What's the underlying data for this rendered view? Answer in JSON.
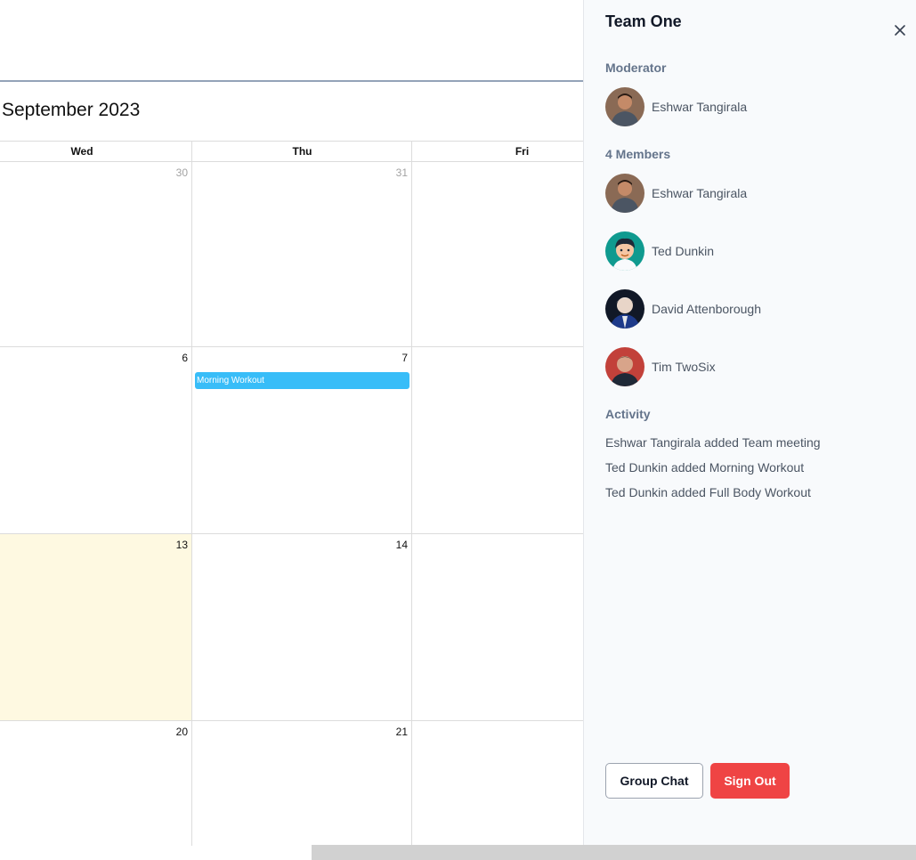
{
  "calendar": {
    "month_title": "September 2023",
    "headers": [
      "Wed",
      "Thu",
      "Fri"
    ],
    "weeks": [
      [
        {
          "day": "30",
          "other": true
        },
        {
          "day": "31",
          "other": true
        },
        {
          "day": "",
          "other": false
        }
      ],
      [
        {
          "day": "6"
        },
        {
          "day": "7",
          "event": "Morning Workout"
        },
        {
          "day": ""
        }
      ],
      [
        {
          "day": "13",
          "today": true
        },
        {
          "day": "14"
        },
        {
          "day": ""
        }
      ],
      [
        {
          "day": "20"
        },
        {
          "day": "21"
        },
        {
          "day": ""
        }
      ]
    ],
    "event_color": "#38bdf8",
    "today_color": "#fef9e1"
  },
  "panel": {
    "title": "Team One",
    "close_icon": "close-icon",
    "moderator_label": "Moderator",
    "moderator": {
      "name": "Eshwar Tangirala",
      "avatar": "person-photo-icon"
    },
    "members_label": "4 Members",
    "members": [
      {
        "name": "Eshwar Tangirala",
        "avatar": "person-photo-icon"
      },
      {
        "name": "Ted Dunkin",
        "avatar": "cartoon-avatar-icon"
      },
      {
        "name": "David Attenborough",
        "avatar": "person-photo-icon"
      },
      {
        "name": "Tim TwoSix",
        "avatar": "person-photo-icon"
      }
    ],
    "activity_label": "Activity",
    "activity": [
      "Eshwar Tangirala added Team meeting",
      "Ted Dunkin added Morning Workout",
      "Ted Dunkin added Full Body Workout"
    ],
    "group_chat_label": "Group Chat",
    "sign_out_label": "Sign Out",
    "danger_color": "#ef4444"
  }
}
